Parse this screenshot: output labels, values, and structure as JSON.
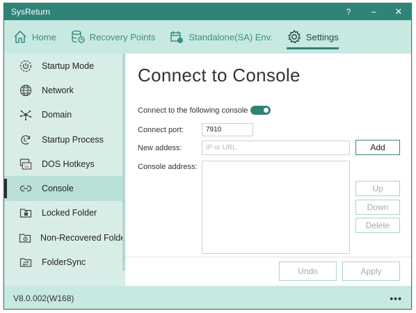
{
  "window": {
    "title": "SysReturn",
    "help_label": "?",
    "minimize_label": "−",
    "close_label": "✕"
  },
  "topnav": {
    "items": [
      {
        "label": "Home",
        "icon": "home-icon"
      },
      {
        "label": "Recovery Points",
        "icon": "database-restore-icon"
      },
      {
        "label": "Standalone(SA) Env.",
        "icon": "calendar-record-icon"
      },
      {
        "label": "Settings",
        "icon": "gear-icon",
        "active": true
      }
    ]
  },
  "sidebar": {
    "items": [
      {
        "label": "Startup Mode",
        "icon": "power-gear-icon"
      },
      {
        "label": "Network",
        "icon": "globe-icon"
      },
      {
        "label": "Domain",
        "icon": "network-nodes-icon"
      },
      {
        "label": "Startup Process",
        "icon": "process-cycle-icon"
      },
      {
        "label": "DOS Hotkeys",
        "icon": "keyboard-icon"
      },
      {
        "label": "Console",
        "icon": "link-icon",
        "active": true
      },
      {
        "label": "Locked Folder",
        "icon": "locked-folder-icon"
      },
      {
        "label": "Non-Recovered Folder",
        "icon": "folder-icon"
      },
      {
        "label": "FolderSync",
        "icon": "folder-sync-icon"
      }
    ]
  },
  "main": {
    "title": "Connect to Console",
    "toggle_label": "Connect to the following console",
    "toggle_on": true,
    "port_label": "Connect port:",
    "port_value": "7910",
    "new_address_label": "New addess:",
    "new_address_placeholder": "IP or URL",
    "console_address_label": "Console address:",
    "buttons": {
      "add": "Add",
      "up": "Up",
      "down": "Down",
      "delete": "Delete",
      "undo": "Undo",
      "apply": "Apply"
    }
  },
  "statusbar": {
    "version": "V8.0.002(W168)",
    "more_label": "•••"
  },
  "colors": {
    "accent": "#2f8377",
    "nav_bg": "#c8e8e2",
    "sidebar_bg": "#d8ede8",
    "sidebar_active": "#b9e0d8"
  }
}
